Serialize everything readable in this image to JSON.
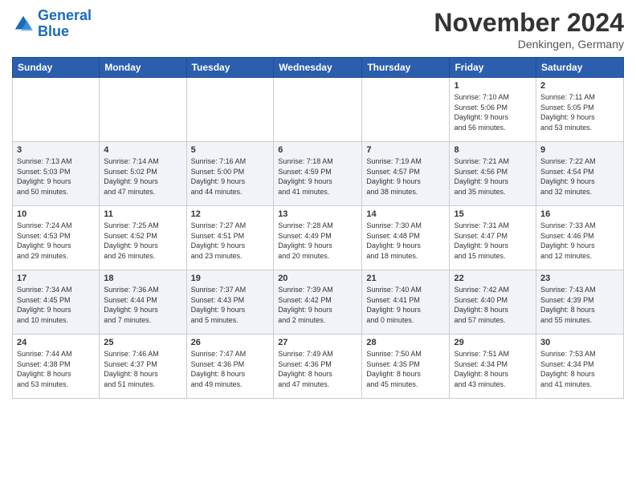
{
  "header": {
    "logo_line1": "General",
    "logo_line2": "Blue",
    "month_title": "November 2024",
    "location": "Denkingen, Germany"
  },
  "weekdays": [
    "Sunday",
    "Monday",
    "Tuesday",
    "Wednesday",
    "Thursday",
    "Friday",
    "Saturday"
  ],
  "weeks": [
    [
      {
        "day": "",
        "info": ""
      },
      {
        "day": "",
        "info": ""
      },
      {
        "day": "",
        "info": ""
      },
      {
        "day": "",
        "info": ""
      },
      {
        "day": "",
        "info": ""
      },
      {
        "day": "1",
        "info": "Sunrise: 7:10 AM\nSunset: 5:06 PM\nDaylight: 9 hours\nand 56 minutes."
      },
      {
        "day": "2",
        "info": "Sunrise: 7:11 AM\nSunset: 5:05 PM\nDaylight: 9 hours\nand 53 minutes."
      }
    ],
    [
      {
        "day": "3",
        "info": "Sunrise: 7:13 AM\nSunset: 5:03 PM\nDaylight: 9 hours\nand 50 minutes."
      },
      {
        "day": "4",
        "info": "Sunrise: 7:14 AM\nSunset: 5:02 PM\nDaylight: 9 hours\nand 47 minutes."
      },
      {
        "day": "5",
        "info": "Sunrise: 7:16 AM\nSunset: 5:00 PM\nDaylight: 9 hours\nand 44 minutes."
      },
      {
        "day": "6",
        "info": "Sunrise: 7:18 AM\nSunset: 4:59 PM\nDaylight: 9 hours\nand 41 minutes."
      },
      {
        "day": "7",
        "info": "Sunrise: 7:19 AM\nSunset: 4:57 PM\nDaylight: 9 hours\nand 38 minutes."
      },
      {
        "day": "8",
        "info": "Sunrise: 7:21 AM\nSunset: 4:56 PM\nDaylight: 9 hours\nand 35 minutes."
      },
      {
        "day": "9",
        "info": "Sunrise: 7:22 AM\nSunset: 4:54 PM\nDaylight: 9 hours\nand 32 minutes."
      }
    ],
    [
      {
        "day": "10",
        "info": "Sunrise: 7:24 AM\nSunset: 4:53 PM\nDaylight: 9 hours\nand 29 minutes."
      },
      {
        "day": "11",
        "info": "Sunrise: 7:25 AM\nSunset: 4:52 PM\nDaylight: 9 hours\nand 26 minutes."
      },
      {
        "day": "12",
        "info": "Sunrise: 7:27 AM\nSunset: 4:51 PM\nDaylight: 9 hours\nand 23 minutes."
      },
      {
        "day": "13",
        "info": "Sunrise: 7:28 AM\nSunset: 4:49 PM\nDaylight: 9 hours\nand 20 minutes."
      },
      {
        "day": "14",
        "info": "Sunrise: 7:30 AM\nSunset: 4:48 PM\nDaylight: 9 hours\nand 18 minutes."
      },
      {
        "day": "15",
        "info": "Sunrise: 7:31 AM\nSunset: 4:47 PM\nDaylight: 9 hours\nand 15 minutes."
      },
      {
        "day": "16",
        "info": "Sunrise: 7:33 AM\nSunset: 4:46 PM\nDaylight: 9 hours\nand 12 minutes."
      }
    ],
    [
      {
        "day": "17",
        "info": "Sunrise: 7:34 AM\nSunset: 4:45 PM\nDaylight: 9 hours\nand 10 minutes."
      },
      {
        "day": "18",
        "info": "Sunrise: 7:36 AM\nSunset: 4:44 PM\nDaylight: 9 hours\nand 7 minutes."
      },
      {
        "day": "19",
        "info": "Sunrise: 7:37 AM\nSunset: 4:43 PM\nDaylight: 9 hours\nand 5 minutes."
      },
      {
        "day": "20",
        "info": "Sunrise: 7:39 AM\nSunset: 4:42 PM\nDaylight: 9 hours\nand 2 minutes."
      },
      {
        "day": "21",
        "info": "Sunrise: 7:40 AM\nSunset: 4:41 PM\nDaylight: 9 hours\nand 0 minutes."
      },
      {
        "day": "22",
        "info": "Sunrise: 7:42 AM\nSunset: 4:40 PM\nDaylight: 8 hours\nand 57 minutes."
      },
      {
        "day": "23",
        "info": "Sunrise: 7:43 AM\nSunset: 4:39 PM\nDaylight: 8 hours\nand 55 minutes."
      }
    ],
    [
      {
        "day": "24",
        "info": "Sunrise: 7:44 AM\nSunset: 4:38 PM\nDaylight: 8 hours\nand 53 minutes."
      },
      {
        "day": "25",
        "info": "Sunrise: 7:46 AM\nSunset: 4:37 PM\nDaylight: 8 hours\nand 51 minutes."
      },
      {
        "day": "26",
        "info": "Sunrise: 7:47 AM\nSunset: 4:36 PM\nDaylight: 8 hours\nand 49 minutes."
      },
      {
        "day": "27",
        "info": "Sunrise: 7:49 AM\nSunset: 4:36 PM\nDaylight: 8 hours\nand 47 minutes."
      },
      {
        "day": "28",
        "info": "Sunrise: 7:50 AM\nSunset: 4:35 PM\nDaylight: 8 hours\nand 45 minutes."
      },
      {
        "day": "29",
        "info": "Sunrise: 7:51 AM\nSunset: 4:34 PM\nDaylight: 8 hours\nand 43 minutes."
      },
      {
        "day": "30",
        "info": "Sunrise: 7:53 AM\nSunset: 4:34 PM\nDaylight: 8 hours\nand 41 minutes."
      }
    ]
  ]
}
